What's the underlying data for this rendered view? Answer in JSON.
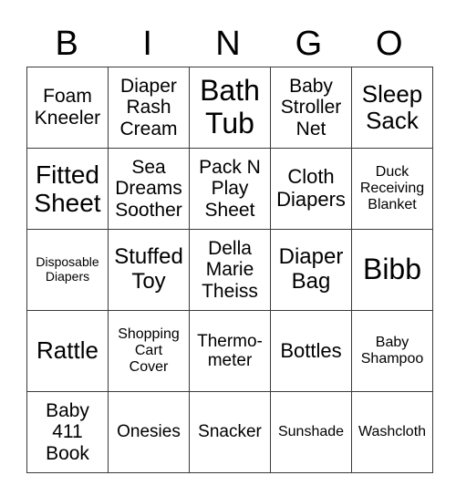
{
  "header": {
    "letters": [
      "B",
      "I",
      "N",
      "G",
      "O"
    ]
  },
  "grid": {
    "rows": [
      [
        "Foam\nKneeler",
        "Diaper\nRash\nCream",
        "Bath\nTub",
        "Baby\nStroller\nNet",
        "Sleep\nSack"
      ],
      [
        "Fitted\nSheet",
        "Sea\nDreams\nSoother",
        "Pack N\nPlay\nSheet",
        "Cloth\nDiapers",
        "Duck\nReceiving\nBlanket"
      ],
      [
        "Disposable\nDiapers",
        "Stuffed\nToy",
        "Della\nMarie\nTheiss",
        "Diaper\nBag",
        "Bibb"
      ],
      [
        "Rattle",
        "Shopping\nCart\nCover",
        "Thermo-\nmeter",
        "Bottles",
        "Baby\nShampoo"
      ],
      [
        "Baby\n411\nBook",
        "Onesies",
        "Snacker",
        "Sunshade",
        "Washcloth"
      ]
    ]
  }
}
